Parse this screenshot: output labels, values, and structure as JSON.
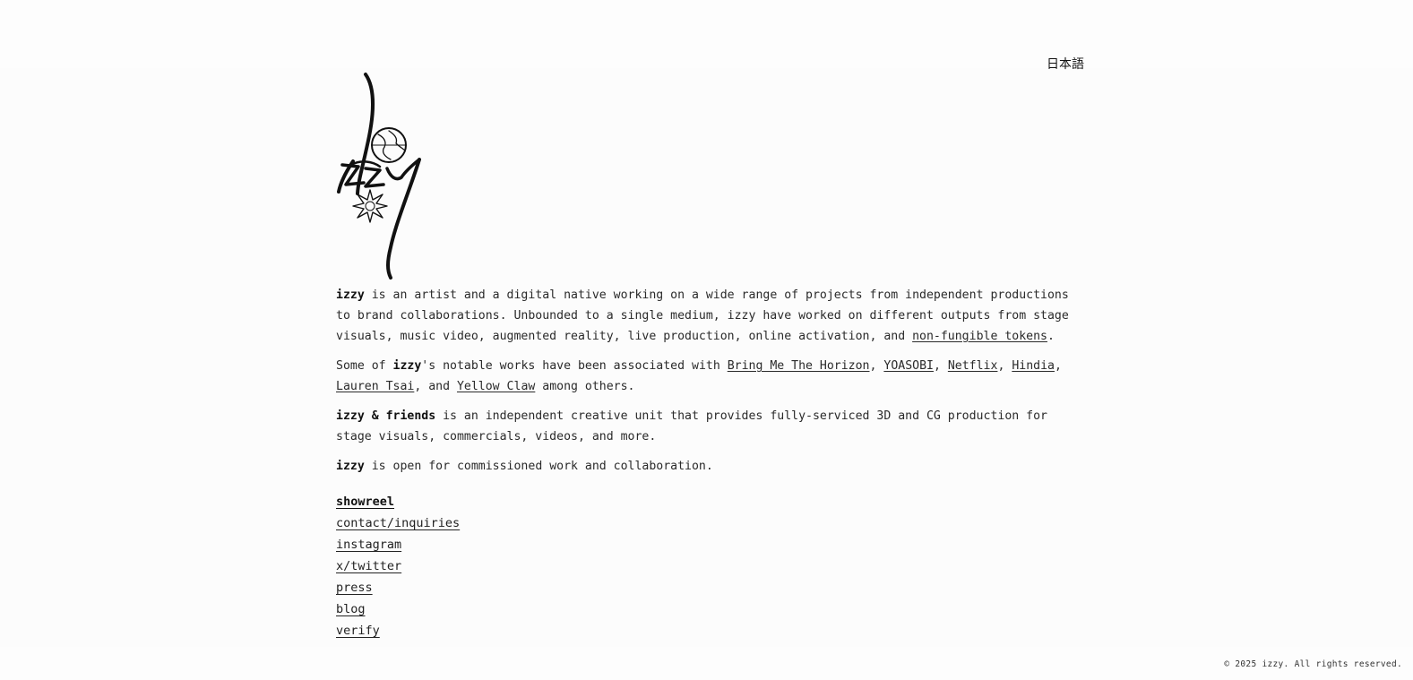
{
  "header": {
    "language_link": "日本語"
  },
  "logo": {
    "wordmark": "izzy"
  },
  "about": {
    "p1": {
      "name": "izzy",
      "text_a": " is an artist and a digital native working on a wide range of projects from independent productions to brand collaborations. Unbounded to a single medium, izzy have worked on different outputs from stage visuals, music video, augmented reality, live production, online activation, and ",
      "nft_link": "non-fungible tokens",
      "text_b": "."
    },
    "p2": {
      "text_a": "Some of ",
      "name": "izzy",
      "text_b": "'s notable works have been associated with ",
      "clients": [
        "Bring Me The Horizon",
        "YOASOBI",
        "Netflix",
        "Hindia",
        "Lauren Tsai",
        "Yellow Claw"
      ],
      "sep": ", ",
      "and": ", and ",
      "text_c": " among others."
    },
    "p3": {
      "name": "izzy & friends",
      "text": " is an independent creative unit that provides fully-serviced 3D and CG production for stage visuals, commercials, videos, and more."
    },
    "p4": {
      "name": "izzy",
      "text": " is open for commissioned work and collaboration."
    }
  },
  "links": [
    {
      "label": "showreel"
    },
    {
      "label": "contact/inquiries"
    },
    {
      "label": "instagram"
    },
    {
      "label": "x/twitter"
    },
    {
      "label": "press"
    },
    {
      "label": "blog"
    },
    {
      "label": "verify"
    }
  ],
  "footer": {
    "copyright": "© 2025 izzy. All rights reserved."
  }
}
